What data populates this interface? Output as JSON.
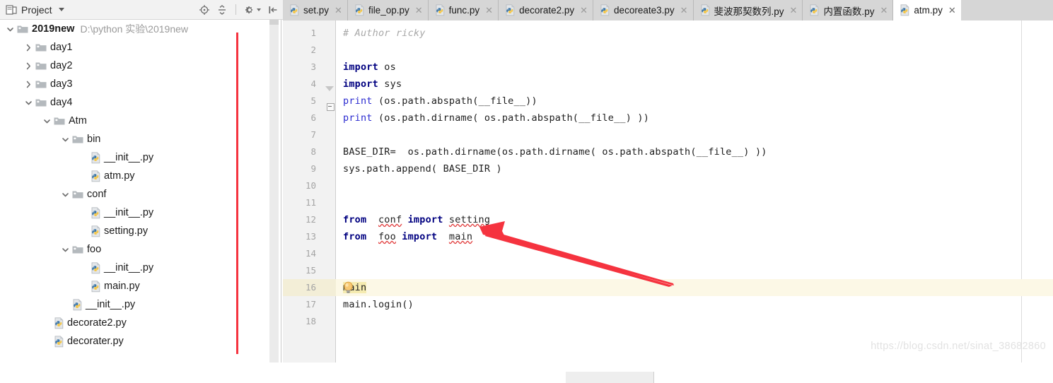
{
  "sidebar": {
    "title": "Project",
    "panel_icon": "project-panel-icon",
    "toolbar": [
      {
        "name": "locate-target-icon",
        "label": "Select Opened File"
      },
      {
        "name": "collapse-all-icon",
        "label": "Collapse All"
      },
      {
        "name": "gear-icon",
        "label": "Settings"
      },
      {
        "name": "hide-panel-icon",
        "label": "Hide"
      }
    ],
    "tree": [
      {
        "label": "2019new",
        "path": "D:\\python 实验\\2019new",
        "kind": "folder",
        "depth": 0,
        "twisty": "down",
        "bold": true
      },
      {
        "label": "day1",
        "kind": "folder",
        "depth": 1,
        "twisty": "right"
      },
      {
        "label": "day2",
        "kind": "folder",
        "depth": 1,
        "twisty": "right"
      },
      {
        "label": "day3",
        "kind": "folder",
        "depth": 1,
        "twisty": "right"
      },
      {
        "label": "day4",
        "kind": "folder",
        "depth": 1,
        "twisty": "down"
      },
      {
        "label": "Atm",
        "kind": "folder",
        "depth": 2,
        "twisty": "down"
      },
      {
        "label": "bin",
        "kind": "folder",
        "depth": 3,
        "twisty": "down"
      },
      {
        "label": "__init__.py",
        "kind": "python",
        "depth": 4,
        "twisty": "none"
      },
      {
        "label": "atm.py",
        "kind": "python",
        "depth": 4,
        "twisty": "none"
      },
      {
        "label": "conf",
        "kind": "folder",
        "depth": 3,
        "twisty": "down"
      },
      {
        "label": "__init__.py",
        "kind": "python",
        "depth": 4,
        "twisty": "none"
      },
      {
        "label": "setting.py",
        "kind": "python",
        "depth": 4,
        "twisty": "none"
      },
      {
        "label": "foo",
        "kind": "folder",
        "depth": 3,
        "twisty": "down"
      },
      {
        "label": "__init__.py",
        "kind": "python",
        "depth": 4,
        "twisty": "none"
      },
      {
        "label": "main.py",
        "kind": "python",
        "depth": 4,
        "twisty": "none"
      },
      {
        "label": "__init__.py",
        "kind": "python",
        "depth": 3,
        "twisty": "none"
      },
      {
        "label": "decorate2.py",
        "kind": "python",
        "depth": 2,
        "twisty": "none"
      },
      {
        "label": "decorater.py",
        "kind": "python",
        "depth": 2,
        "twisty": "none"
      }
    ]
  },
  "tabs": [
    {
      "label": "set.py",
      "active": false
    },
    {
      "label": "file_op.py",
      "active": false
    },
    {
      "label": "func.py",
      "active": false
    },
    {
      "label": "decorate2.py",
      "active": false
    },
    {
      "label": "decoreate3.py",
      "active": false
    },
    {
      "label": "斐波那契数列.py",
      "active": false
    },
    {
      "label": "内置函数.py",
      "active": false
    },
    {
      "label": "atm.py",
      "active": true
    }
  ],
  "editor": {
    "line_numbers": [
      "1",
      "2",
      "3",
      "4",
      "5",
      "6",
      "7",
      "8",
      "9",
      "10",
      "11",
      "12",
      "13",
      "14",
      "15",
      "16",
      "17",
      "18"
    ],
    "highlighted_line": "16",
    "bulb_icon": "intention-bulb-icon",
    "lines": [
      "# Author ricky",
      "",
      "import os",
      "import sys",
      "print (os.path.abspath(__file__))",
      "print (os.path.dirname( os.path.abspath(__file__) ))",
      "",
      "BASE_DIR=  os.path.dirname(os.path.dirname( os.path.abspath(__file__) ))",
      "sys.path.append( BASE_DIR )",
      "",
      "",
      "from  conf import setting",
      "from  foo import  main",
      "",
      "",
      "main",
      "main.login()",
      ""
    ]
  },
  "annotation": {
    "arrow_color": "#f5333f",
    "marker_line_color": "#f5333f"
  },
  "watermark": "https://blog.csdn.net/sinat_38682860"
}
